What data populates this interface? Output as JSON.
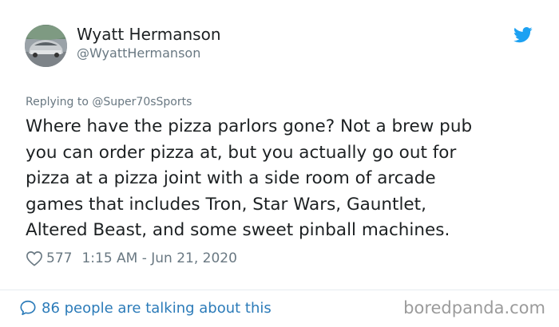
{
  "author": {
    "name": "Wyatt Hermanson",
    "handle": "@WyattHermanson",
    "avatar_icon": "car-avatar"
  },
  "reply": {
    "prefix": "Replying to ",
    "to": "@Super70sSports"
  },
  "tweet": {
    "text": "Where have the pizza parlors gone?  Not a brew pub\nyou can order pizza at, but you actually go out for\npizza at a pizza joint with a side room of arcade\ngames that includes Tron, Star Wars, Gauntlet,\nAltered Beast, and some sweet pinball machines.",
    "likes": "577",
    "time": "1:15 AM - Jun 21, 2020"
  },
  "footer": {
    "conversation": "86 people are talking about this",
    "brand": "boredpanda.com"
  },
  "colors": {
    "twitter_blue": "#1da1f2",
    "link_blue": "#2b7bb9",
    "muted": "#697882",
    "text": "#1c2022"
  }
}
